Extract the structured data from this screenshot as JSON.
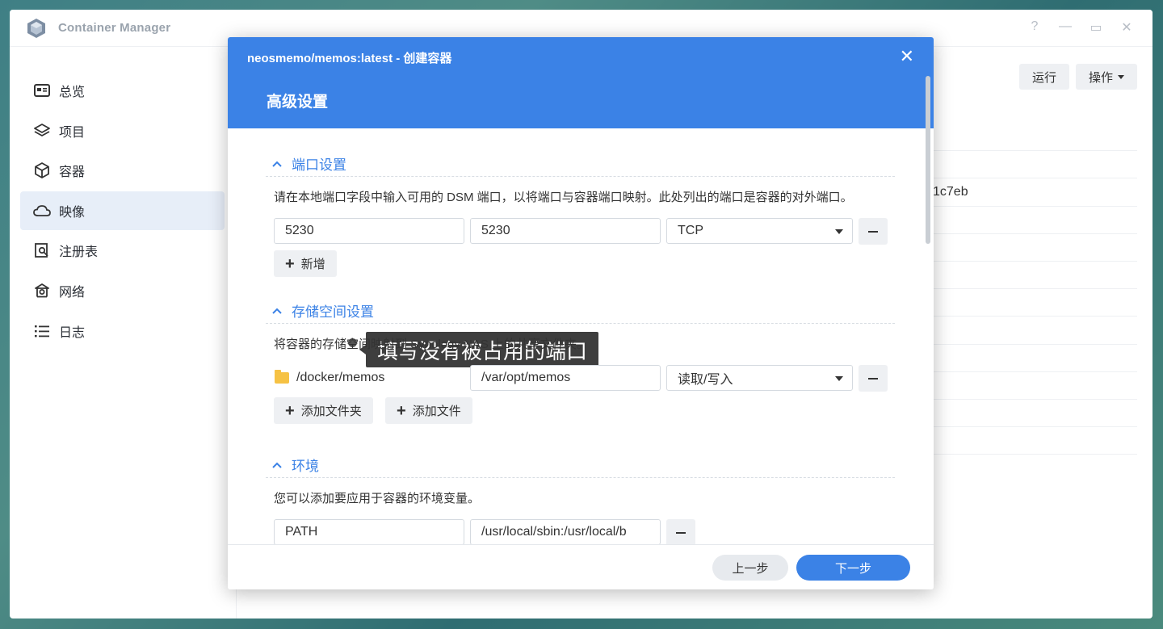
{
  "app": {
    "title": "Container Manager",
    "window_controls": {
      "help": "?",
      "minimize": "—",
      "maximize": "▭",
      "close": "✕"
    }
  },
  "sidebar": {
    "items": [
      {
        "label": "总览",
        "icon": "overview-icon",
        "active": false
      },
      {
        "label": "项目",
        "icon": "layers-icon",
        "active": false
      },
      {
        "label": "容器",
        "icon": "cube-icon",
        "active": false
      },
      {
        "label": "映像",
        "icon": "cloud-icon",
        "active": true
      },
      {
        "label": "注册表",
        "icon": "registry-search-icon",
        "active": false
      },
      {
        "label": "网络",
        "icon": "network-icon",
        "active": false
      },
      {
        "label": "日志",
        "icon": "list-icon",
        "active": false
      }
    ]
  },
  "toolbar": {
    "run_label": "运行",
    "actions_label": "操作"
  },
  "background_table": {
    "visible_fragment": "1c7eb"
  },
  "dialog": {
    "title": "neosmemo/memos:latest - 创建容器",
    "close_icon": "✕",
    "subtitle": "高级设置",
    "port_section": {
      "heading": "端口设置",
      "description": "请在本地端口字段中输入可用的 DSM 端口，以将端口与容器端口映射。此处列出的端口是容器的对外端口。",
      "local_port": "5230",
      "container_port": "5230",
      "protocol": "TCP",
      "add_label": "新增"
    },
    "tooltip": "填写没有被占用的端口",
    "storage_section": {
      "heading": "存储空间设置",
      "description": "将容器的存储空间映射到 Synology NAS 上的共享文件夹。",
      "folder": "/docker/memos",
      "mount_path": "/var/opt/memos",
      "permission": "读取/写入",
      "add_folder_label": "添加文件夹",
      "add_file_label": "添加文件"
    },
    "env_section": {
      "heading": "环境",
      "description": "您可以添加要应用于容器的环境变量。",
      "var_name": "PATH",
      "var_value": "/usr/local/sbin:/usr/local/b"
    },
    "footer": {
      "prev_label": "上一步",
      "next_label": "下一步"
    }
  },
  "colors": {
    "accent": "#3b82e6",
    "sidebar_active": "#e7eef8",
    "button_bg": "#eef0f3"
  }
}
